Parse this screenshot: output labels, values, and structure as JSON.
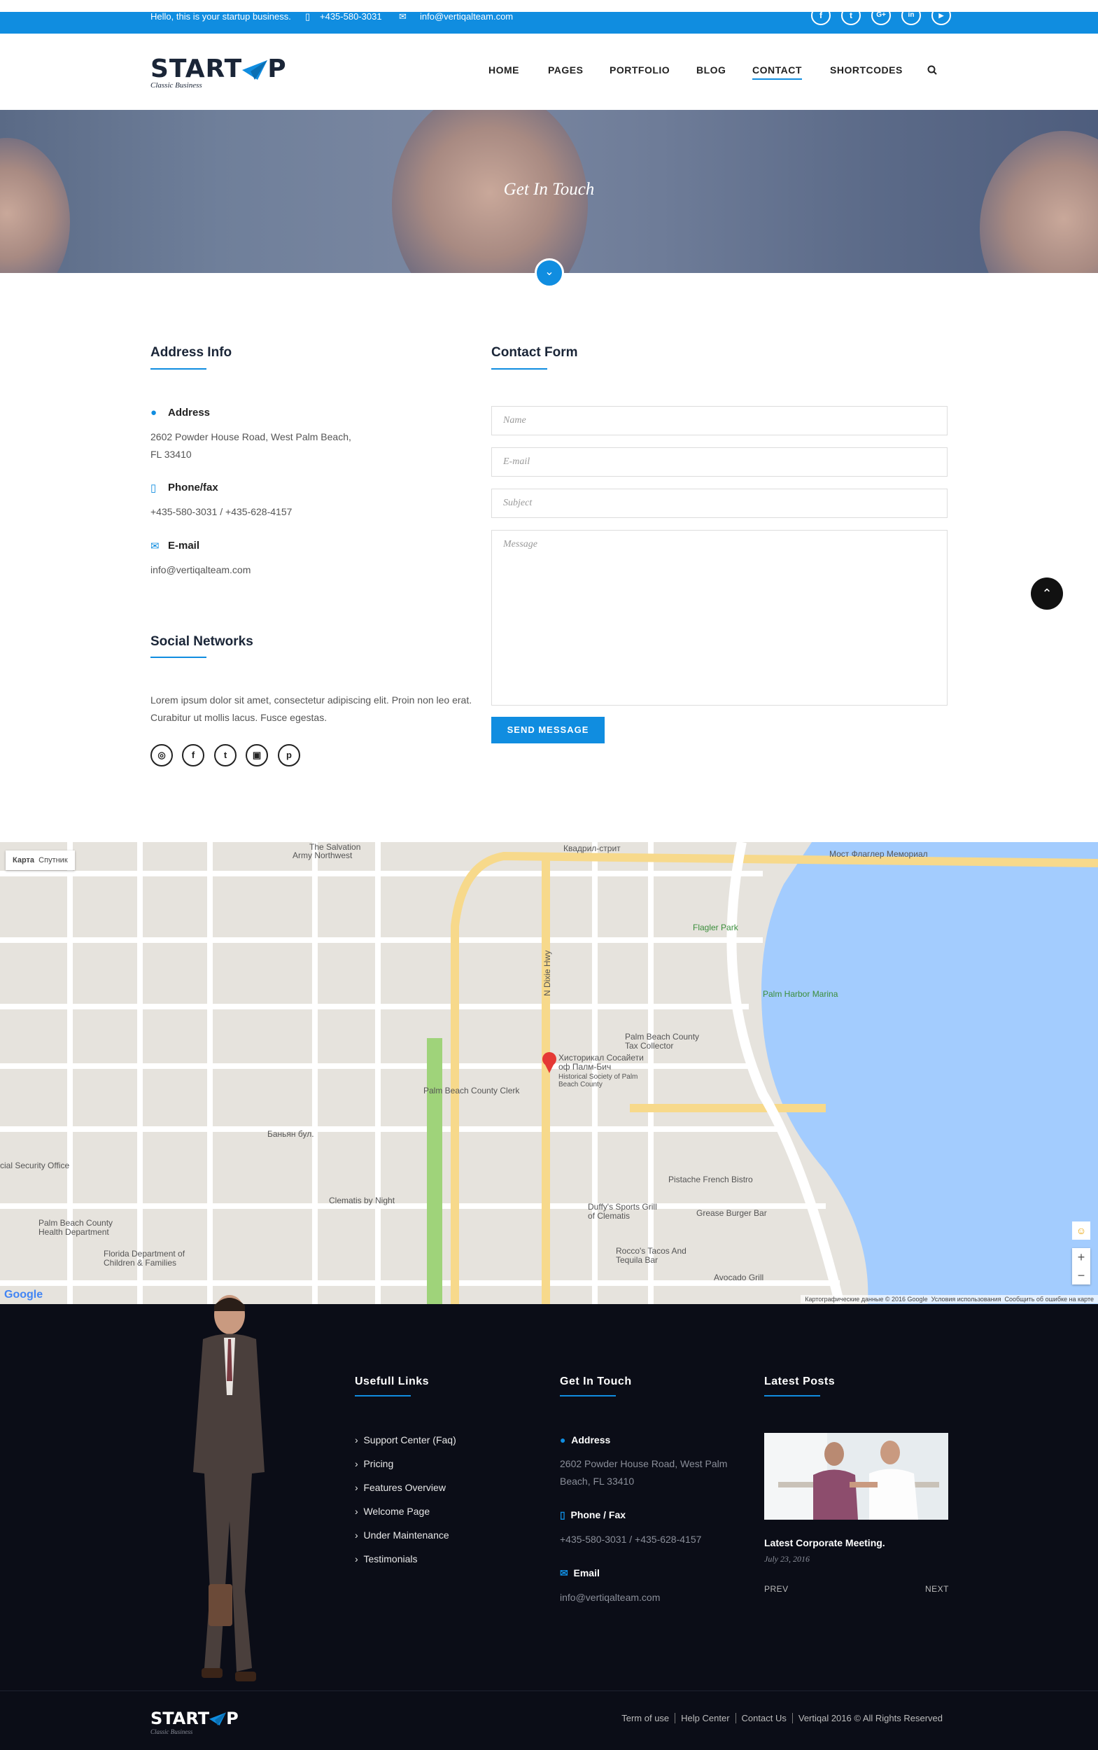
{
  "topbar": {
    "tagline": "Hello, this is your startup business.",
    "phone": "+435-580-3031",
    "email": "info@vertiqalteam.com",
    "social": [
      "f",
      "t",
      "G+",
      "in",
      "▶"
    ]
  },
  "brand": {
    "name": "START",
    "name_tail": "P",
    "tagline": "Classic Business"
  },
  "nav": [
    "HOME",
    "PAGES",
    "PORTFOLIO",
    "BLOG",
    "CONTACT",
    "SHORTCODES"
  ],
  "hero": {
    "title": "Get In Touch"
  },
  "address_info": {
    "title": "Address Info",
    "address_label": "Address",
    "address": "2602 Powder House Road, West Palm Beach, FL 33410",
    "phone_label": "Phone/fax",
    "phone": "+435-580-3031 / +435-628-4157",
    "email_label": "E-mail",
    "email": "info@vertiqalteam.com"
  },
  "social_networks": {
    "title": "Social Networks",
    "text": "Lorem ipsum dolor sit amet, consectetur adipiscing elit. Proin non leo erat. Curabitur ut mollis lacus. Fusce egestas."
  },
  "contact_form": {
    "title": "Contact Form",
    "name_placeholder": "Name",
    "email_placeholder": "E-mail",
    "subject_placeholder": "Subject",
    "message_placeholder": "Message",
    "send": "SEND MESSAGE"
  },
  "map": {
    "type_map": "Карта",
    "type_satellite": "Спутник",
    "labels": [
      "Мост Флаглер Мемориал",
      "Квадрил-стрит",
      "Flagler Park",
      "Palm Harbor Marina",
      "Palm Beach County Tax Collector",
      "Хисторикал Сосайети оф Палм-Бич",
      "Historical Society of Palm Beach County",
      "Palm Beach County Clerk",
      "Pistache French Bistro",
      "Duffy's Sports Grill of Clematis",
      "Grease Burger Bar",
      "Rocco's Tacos And Tequila Bar",
      "Avocado Grill",
      "Clematis by Night",
      "Palm Beach County Health Department",
      "Florida Department of Children & Families",
      "cial Security Office",
      "N Dixie Hwy",
      "Баньян бул.",
      "Army Northwest",
      "The Salvation"
    ],
    "attribution": "Картографические данные © 2016 Google",
    "terms": "Условия использования",
    "report": "Сообщить об ошибке на карте",
    "google": "Google"
  },
  "footer": {
    "links_title": "Usefull Links",
    "links": [
      "Support Center (Faq)",
      "Pricing",
      "Features Overview",
      "Welcome Page",
      "Under Maintenance",
      "Testimonials"
    ],
    "touch_title": "Get In Touch",
    "address_label": "Address",
    "address": "2602 Powder House Road, West Palm Beach, FL 33410",
    "phone_label": "Phone / Fax",
    "phone": "+435-580-3031 / +435-628-4157",
    "email_label": "Email",
    "email": "info@vertiqalteam.com",
    "posts_title": "Latest Posts",
    "post_title": "Latest Corporate Meeting.",
    "post_date": "July 23, 2016",
    "prev": "PREV",
    "next": "NEXT",
    "bottom_links": [
      "Term of use",
      "Help Center",
      "Contact Us",
      "Vertiqal 2016 © All Rights Reserved"
    ]
  },
  "colors": {
    "accent": "#108de0",
    "dark": "#0b0d17",
    "heading": "#1a2537"
  }
}
